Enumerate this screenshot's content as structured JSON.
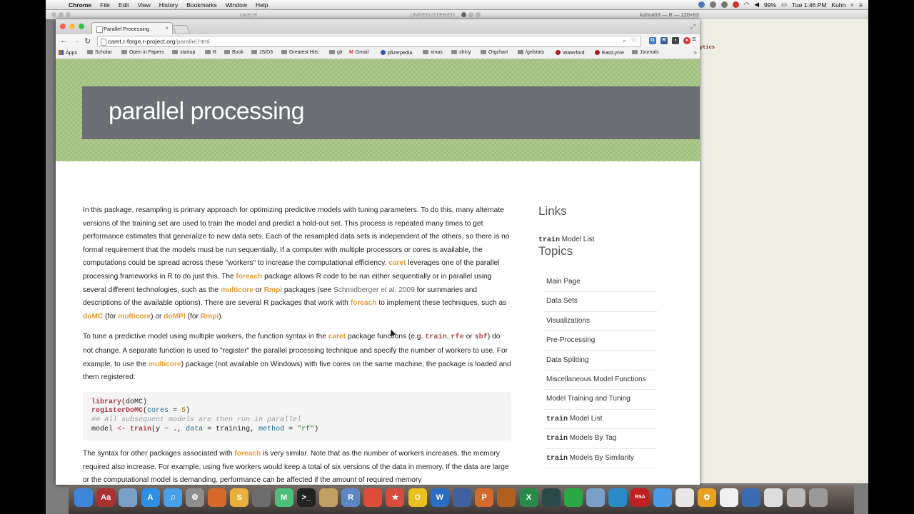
{
  "menubar": {
    "apple": "",
    "app": "Chrome",
    "menus": [
      "File",
      "Edit",
      "View",
      "History",
      "Bookmarks",
      "Window",
      "Help"
    ],
    "battery": "99%",
    "clock": "Tue 1:46 PM",
    "user": "Kuhn"
  },
  "terminal": {
    "unregistered": "UNREGISTERED",
    "caret_file": "caret.R",
    "title": "kuhna03 — R — 120×63",
    "visible_text": "ytics"
  },
  "browser": {
    "tab_title": "Parallel Processing",
    "tab_close": "×",
    "url_host": "caret.r-forge.r-project.org",
    "url_path": "/parallel.html",
    "bookmarks": [
      {
        "label": "Apps",
        "kind": "apps"
      },
      {
        "label": "Scholar",
        "kind": "folder"
      },
      {
        "label": "Open in Papers",
        "kind": "folder"
      },
      {
        "label": "startup",
        "kind": "folder"
      },
      {
        "label": "R",
        "kind": "folder"
      },
      {
        "label": "Book",
        "kind": "folder"
      },
      {
        "label": "JS/D3",
        "kind": "folder"
      },
      {
        "label": "Greatest Hits",
        "kind": "folder"
      },
      {
        "label": "git",
        "kind": "folder"
      },
      {
        "label": "Gmail",
        "kind": "gmail"
      },
      {
        "label": "pfizerpedia",
        "kind": "site"
      },
      {
        "label": "xmas",
        "kind": "folder"
      },
      {
        "label": "shiny",
        "kind": "folder"
      },
      {
        "label": "Orgchart",
        "kind": "folder"
      },
      {
        "label": "/gnlstats",
        "kind": "folder"
      },
      {
        "label": "Waterford",
        "kind": "red"
      },
      {
        "label": "EastLyme",
        "kind": "red"
      },
      {
        "label": "Journals",
        "kind": "folder"
      }
    ]
  },
  "page": {
    "title": "parallel processing",
    "p1": {
      "a": "In this package, resampling is primary approach for optimizing predictive models with tuning parameters. To do this, many alternate versions of the training set are used to train the model and predict a hold-out set. This process is repeated many times to get performance estimates that generalize to new data sets. Each of the resampled data sets is independent of the others, so there is no formal requirement that the models must be run sequentially. If a computer with multiple processors or cores is available, the computations could be spread across these \"workers\" to increase the computational efficiency.",
      "caret": "caret",
      "b": "leverages one of the parallel processing frameworks in R to do just this. The",
      "foreach": "foreach",
      "c": "package allows R code to be run either sequentially or in parallel using several different technologies, such as the",
      "multicore": "multicore",
      "or": "or",
      "rmpi": "Rmpi",
      "d": "packages (see",
      "cite": "Schmidberger et al, 2009",
      "e": "for summaries and descriptions of the available options). There are several R packages that work with",
      "f": "to implement these techniques, such as",
      "domc": "doMC",
      "for_open": "(for",
      "close_or": ") or",
      "dompi": "doMPI",
      "close_end": ")."
    },
    "p2": {
      "a": "To tune a predictive model using multiple workers, the function syntax in the",
      "b": "package functions (e.g.",
      "train": "train",
      "comma": ",",
      "rfe": "rfe",
      "or": "or",
      "sbf": "sbf",
      "c": ") do not change. A separate function is used to \"register\" the parallel processing technique and specify the number of workers to use. For example, to use the",
      "d": ") package (not available on Windows) with five cores on the same machine, the package is loaded and them registered:"
    },
    "code": {
      "l1_fn": "library",
      "l1_arg": "(doMC)",
      "l2_fn": "registerDoMC",
      "l2_open": "(",
      "l2_arg": "cores",
      "l2_eq": " = ",
      "l2_num": "5",
      "l2_close": ")",
      "l3_comment": "## All subsequent models are then run in parallel",
      "l4_a": "model ",
      "l4_assign": "<-",
      "l4_sp": " ",
      "l4_fn": "train",
      "l4_b": "(y ~ ., ",
      "l4_data": "data",
      "l4_c": " = training, ",
      "l4_method": "method",
      "l4_d": " = ",
      "l4_str": "\"rf\"",
      "l4_e": ")"
    },
    "p3": {
      "a": "The syntax for other packages associated with",
      "foreach": "foreach",
      "b": "is very similar. Note that as the number of workers increases, the memory required also increase. For example, using five workers would keep a total of six versions of the data in memory. If the data are large or the computational model is demanding, performance can be affected if the amount of required memory"
    },
    "sidebar": {
      "links_heading": "Links",
      "link_mono": "train",
      "link_rest": " Model List",
      "topics_heading": "Topics",
      "topics": [
        {
          "mono": "",
          "text": "Main Page"
        },
        {
          "mono": "",
          "text": "Data Sets"
        },
        {
          "mono": "",
          "text": "Visualizations"
        },
        {
          "mono": "",
          "text": "Pre-Processing"
        },
        {
          "mono": "",
          "text": "Data Splitting"
        },
        {
          "mono": "",
          "text": "Miscellaneous Model Functions"
        },
        {
          "mono": "",
          "text": "Model Training and Tuning"
        },
        {
          "mono": "train",
          "text": " Model List"
        },
        {
          "mono": "train",
          "text": " Models By Tag"
        },
        {
          "mono": "train",
          "text": " Models By Similarity"
        }
      ]
    }
  },
  "colors": {
    "highlight": "#e69b3a",
    "banner": "#6b6f73",
    "hero": "#a6c684"
  },
  "dock": [
    {
      "name": "finder-icon",
      "color": "#3d86d8",
      "glyph": ""
    },
    {
      "name": "dictionary-icon",
      "color": "#a83232",
      "glyph": "Aa"
    },
    {
      "name": "preview-icon",
      "color": "#7ba0c8",
      "glyph": ""
    },
    {
      "name": "app-store-icon",
      "color": "#2d8ee6",
      "glyph": "A"
    },
    {
      "name": "itunes-icon",
      "color": "#4aa0e8",
      "glyph": "♫"
    },
    {
      "name": "system-preferences-icon",
      "color": "#8d8d8d",
      "glyph": "⚙"
    },
    {
      "name": "matlab-icon",
      "color": "#d46a2a",
      "glyph": ""
    },
    {
      "name": "slack-icon",
      "color": "#e8b03a",
      "glyph": "S"
    },
    {
      "name": "sequel-icon",
      "color": "#6c6c6c",
      "glyph": ""
    },
    {
      "name": "m-app-icon",
      "color": "#4cbf7a",
      "glyph": "M"
    },
    {
      "name": "terminal-icon",
      "color": "#222222",
      "glyph": ">_"
    },
    {
      "name": "box-icon",
      "color": "#c0a060",
      "glyph": ""
    },
    {
      "name": "r-icon",
      "color": "#5e86c4",
      "glyph": "R"
    },
    {
      "name": "chrome-icon",
      "color": "#dd4b39",
      "glyph": ""
    },
    {
      "name": "bookmark-app-icon",
      "color": "#d84a3a",
      "glyph": "★"
    },
    {
      "name": "outlook-icon",
      "color": "#e8c020",
      "glyph": "O"
    },
    {
      "name": "word-icon",
      "color": "#2b6cc4",
      "glyph": "W"
    },
    {
      "name": "quill-icon",
      "color": "#4060a0",
      "glyph": ""
    },
    {
      "name": "powerpoint-icon",
      "color": "#d46a2a",
      "glyph": "P"
    },
    {
      "name": "presentation-icon",
      "color": "#b06020",
      "glyph": ""
    },
    {
      "name": "excel-icon",
      "color": "#2a8a4a",
      "glyph": "X"
    },
    {
      "name": "activity-monitor-icon",
      "color": "#2a4a4a",
      "glyph": ""
    },
    {
      "name": "spotify-icon",
      "color": "#2aa845",
      "glyph": ""
    },
    {
      "name": "wifi-icon",
      "color": "#7aa0c8",
      "glyph": ""
    },
    {
      "name": "safari-globe-icon",
      "color": "#2a8ac8",
      "glyph": ""
    },
    {
      "name": "rsa-securid-icon",
      "color": "#c02020",
      "glyph": "RSA"
    },
    {
      "name": "safari-icon",
      "color": "#4a9ae8",
      "glyph": ""
    },
    {
      "name": "document-icon",
      "color": "#e8e8e8",
      "glyph": ""
    },
    {
      "name": "flower-icon",
      "color": "#e8a020",
      "glyph": "✿"
    },
    {
      "name": "file-icon",
      "color": "#f0f0f0",
      "glyph": ""
    },
    {
      "name": "onepassword-icon",
      "color": "#3a6ab0",
      "glyph": ""
    },
    {
      "name": "folder-icon",
      "color": "#dddddd",
      "glyph": ""
    },
    {
      "name": "stack-icon",
      "color": "#bbbbbb",
      "glyph": ""
    },
    {
      "name": "trash-icon",
      "color": "#999999",
      "glyph": ""
    }
  ]
}
